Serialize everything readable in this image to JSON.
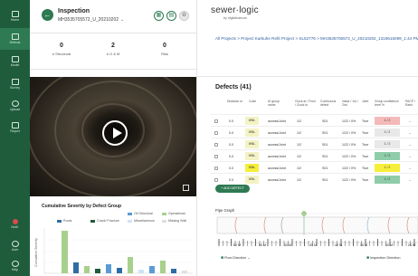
{
  "nav": {
    "items": [
      {
        "icon": "home-icon",
        "label": "Home"
      },
      {
        "icon": "defects-icon",
        "label": "Defects"
      },
      {
        "icon": "list-icon",
        "label": "Model"
      },
      {
        "icon": "ruler-icon",
        "label": "Survey"
      },
      {
        "icon": "cloud-upload-icon",
        "label": "Upload"
      },
      {
        "icon": "document-icon",
        "label": "Report"
      },
      {
        "icon": "notification-icon",
        "label": "Notif."
      },
      {
        "icon": "user-icon",
        "label": "User"
      },
      {
        "icon": "help-icon",
        "label": "Help"
      }
    ]
  },
  "inspection": {
    "title": "Inspection",
    "id": "MH3535705572_U_20210202",
    "chevron": "⌄"
  },
  "counts": [
    {
      "value": "0",
      "label": "# Structural"
    },
    {
      "value": "2",
      "label": "# O & M"
    },
    {
      "value": "0",
      "label": "Risk"
    }
  ],
  "severity": {
    "title": "Cumulative Severity by Defect Group",
    "legend": [
      {
        "label": "Roots",
        "color": "#2e6da4"
      },
      {
        "label": "Crack/ Fracture",
        "color": "#1f5c3c"
      },
      {
        "label": "Oil Structural",
        "color": "#5b9bd5"
      },
      {
        "label": "Operational",
        "color": "#a8d08d"
      },
      {
        "label": "Miscellaneous",
        "color": "#cfe3f4"
      },
      {
        "label": "Missing Wall",
        "color": "#e0e0e0"
      }
    ],
    "ylabel": "Cumulative Severity"
  },
  "brand": {
    "name": "sewer·logic",
    "tagline": "by digitalnaecon"
  },
  "breadcrumb": "All Projects > Project Karkuhe Refit Project > SL52776 > MH3535705572_U_20210202_1319615099_1:44 PM",
  "defects": {
    "title": "Defects (41)",
    "headers": [
      "Distance m",
      "Code",
      "AI group name",
      "Clock at / From / Clock to",
      "Continuous defect",
      "Value / 1st / 2nd",
      "Joint",
      "Group confidence level %",
      "PACP / Rank"
    ],
    "rows": [
      {
        "distance": "0.0",
        "code": "WNL",
        "group": "access/Joint",
        "clock": "1/2",
        "continuous": "S01",
        "value": "1/22 / 0%",
        "joint": "True",
        "grade": "1 / 2",
        "rank": "--",
        "code_color": "#f3f3c4",
        "grade_color": "#f4b9b9"
      },
      {
        "distance": "0.0",
        "code": "WNL",
        "group": "access/Joint",
        "clock": "1/2",
        "continuous": "S01",
        "value": "1/22 / 0%",
        "joint": "True",
        "grade": "1 / 2",
        "rank": "--",
        "code_color": "#f3f3c4",
        "grade_color": "#e8e8e8"
      },
      {
        "distance": "0.0",
        "code": "WNL",
        "group": "access/Joint",
        "clock": "1/2",
        "continuous": "S01",
        "value": "1/22 / 0%",
        "joint": "True",
        "grade": "1 / 2",
        "rank": "--",
        "code_color": "#f3f3c4",
        "grade_color": "#e8e8e8"
      },
      {
        "distance": "0.0",
        "code": "WNL",
        "group": "access/Joint",
        "clock": "1/2",
        "continuous": "S01",
        "value": "1/22 / 0%",
        "joint": "True",
        "grade": "1 / 2",
        "rank": "--",
        "code_color": "#f3f3c4",
        "grade_color": "#8fcca9"
      },
      {
        "distance": "0.0",
        "code": "WNL",
        "group": "access/Joint",
        "clock": "1/2",
        "continuous": "S01",
        "value": "1/22 / 0%",
        "joint": "True",
        "grade": "1 / 2",
        "rank": "--",
        "code_color": "#f6ee3a",
        "grade_color": "#f6ee3a"
      },
      {
        "distance": "0.0",
        "code": "WNL",
        "group": "access/Joint",
        "clock": "1/2",
        "continuous": "S01",
        "value": "1/22 / 0%",
        "joint": "True",
        "grade": "1 / 2",
        "rank": "--",
        "code_color": "#f3f3c4",
        "grade_color": "#8fcca9"
      }
    ],
    "add_label": "+ ADD DEFECT"
  },
  "pipe": {
    "title": "Pipe Graph",
    "scale_labels": [
      "60 M",
      "55 M",
      "50 M",
      "45 M",
      "40 M",
      "35 M",
      "30 M",
      "25 M"
    ],
    "flow_label": "Flow Direction",
    "flow_arrow": "→",
    "inspection_label": "Inspection Direction"
  }
}
